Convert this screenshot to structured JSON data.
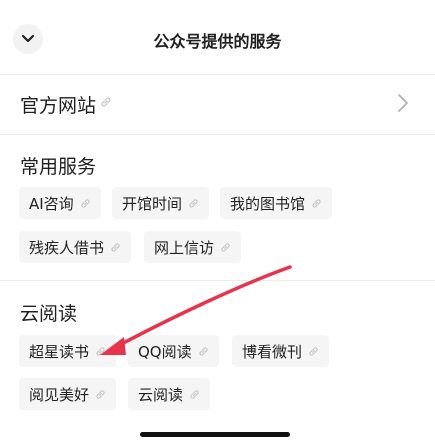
{
  "header": {
    "title": "公众号提供的服务"
  },
  "official": {
    "label": "官方网站"
  },
  "sections": [
    {
      "title": "常用服务",
      "items": [
        {
          "label": "AI咨询"
        },
        {
          "label": "开馆时间"
        },
        {
          "label": "我的图书馆"
        },
        {
          "label": "残疾人借书"
        },
        {
          "label": "网上信访"
        }
      ]
    },
    {
      "title": "云阅读",
      "items": [
        {
          "label": "超星读书"
        },
        {
          "label": "QQ阅读"
        },
        {
          "label": "博看微刊"
        },
        {
          "label": "阅见美好"
        },
        {
          "label": "云阅读"
        }
      ]
    }
  ],
  "colors": {
    "annotation_arrow": "#e8344a",
    "chip_bg": "#f5f5f5",
    "divider": "#ececec"
  },
  "icons": {
    "collapse": "chevron-down-icon",
    "link": "link-icon",
    "navigate": "chevron-right-icon"
  }
}
